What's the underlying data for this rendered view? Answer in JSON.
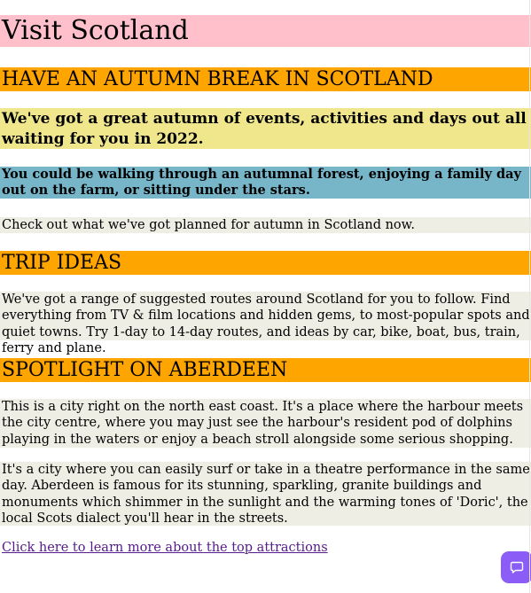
{
  "page": {
    "title": "Visit Scotland"
  },
  "autumn": {
    "heading": "HAVE AN AUTUMN BREAK IN SCOTLAND",
    "subheading": "We've got a great autumn of events, activities and days out all waiting for you in 2022.",
    "description": "You could be walking through an autumnal forest, enjoying a family day out on the farm, or sitting under the stars.",
    "cta": "Check out what we've got planned for autumn in Scotland now."
  },
  "trip_ideas": {
    "heading": "TRIP IDEAS",
    "body": "We've got a range of suggested routes around Scotland for you to follow. Find everything from TV & film locations and hidden gems, to most-popular spots and quiet towns. Try 1-day to 14-day routes, and ideas by car, bike, boat, bus, train, ferry and plane."
  },
  "spotlight": {
    "heading": "SPOTLIGHT ON ABERDEEN",
    "paragraph1": "This is a city right on the north east coast. It's a place where the harbour meets the city centre, where you may just see the harbour's resident pod of dolphins playing in the waters or enjoy a beach stroll alongside some serious shopping.",
    "paragraph2": "It's a city where you can easily surf or take in a theatre performance in the same day. Aberdeen is famous for its stunning, sparkling, granite buildings and monuments which shimmer in the sunlight and the warming tones of 'Doric', the local Scots dialect you'll hear in the streets.",
    "link_text": "Click here to learn more about the top attractions"
  },
  "chat": {
    "icon": "chat-bubble-icon"
  },
  "colors": {
    "title_bg": "#ffc0cb",
    "heading_bg": "#ffa500",
    "subheading_bg": "#f0e68c",
    "description_bg": "#77b5c8",
    "body_bg": "#eeeee4",
    "link": "#551a8b",
    "chat_button": "#8b5cf6"
  }
}
